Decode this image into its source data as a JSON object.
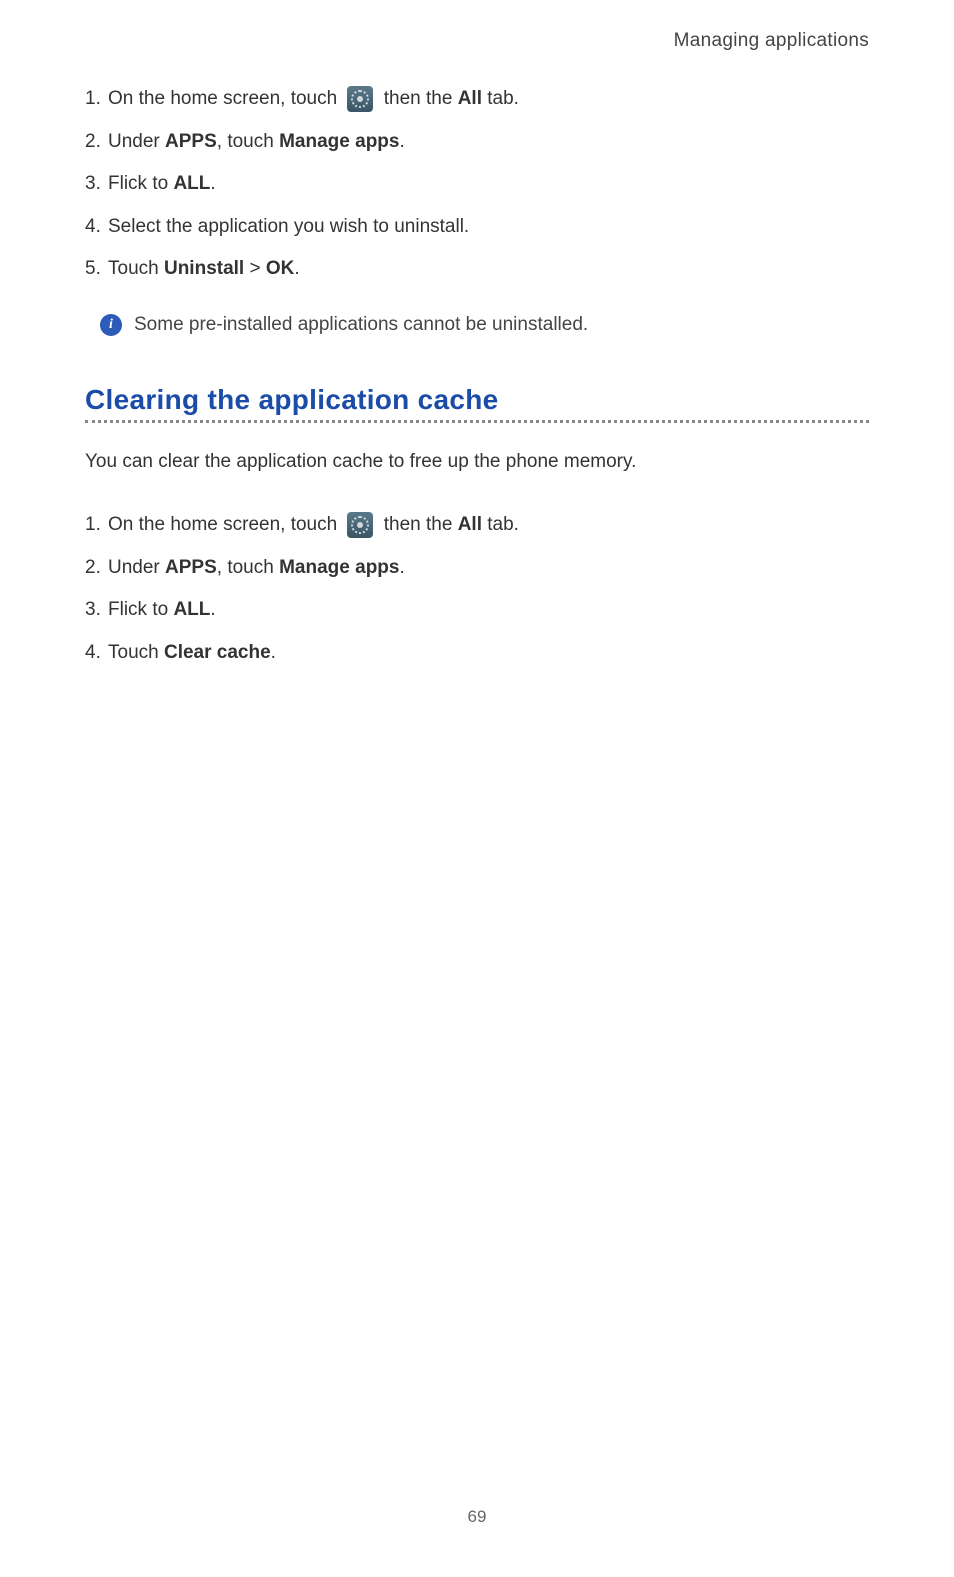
{
  "header": {
    "title": "Managing applications"
  },
  "uninstall_steps": {
    "step1": {
      "number": "1.",
      "text_before": "On the home screen, touch ",
      "text_after_icon": " then the ",
      "bold1": "All",
      "text_end": " tab."
    },
    "step2": {
      "number": "2.",
      "text1": "Under ",
      "bold1": "APPS",
      "text2": ", touch ",
      "bold2": "Manage apps",
      "text3": "."
    },
    "step3": {
      "number": "3.",
      "text1": "Flick to ",
      "bold1": "ALL",
      "text2": "."
    },
    "step4": {
      "number": "4.",
      "text1": "Select the application you wish to uninstall."
    },
    "step5": {
      "number": "5.",
      "text1": "Touch ",
      "bold1": "Uninstall",
      "text2": " > ",
      "bold2": "OK",
      "text3": "."
    }
  },
  "info_note": {
    "icon_char": "i",
    "text": "Some pre-installed applications cannot be uninstalled."
  },
  "section_heading": "Clearing the application cache",
  "intro_text": "You can clear the application cache to free up the phone memory.",
  "cache_steps": {
    "step1": {
      "number": "1.",
      "text_before": "On the home screen, touch ",
      "text_after_icon": " then the ",
      "bold1": "All",
      "text_end": " tab."
    },
    "step2": {
      "number": "2.",
      "text1": "Under ",
      "bold1": "APPS",
      "text2": ", touch ",
      "bold2": "Manage apps",
      "text3": "."
    },
    "step3": {
      "number": "3.",
      "text1": "Flick to ",
      "bold1": "ALL",
      "text2": "."
    },
    "step4": {
      "number": "4.",
      "text1": "Touch ",
      "bold1": "Clear cache",
      "text2": "."
    }
  },
  "page_number": "69"
}
